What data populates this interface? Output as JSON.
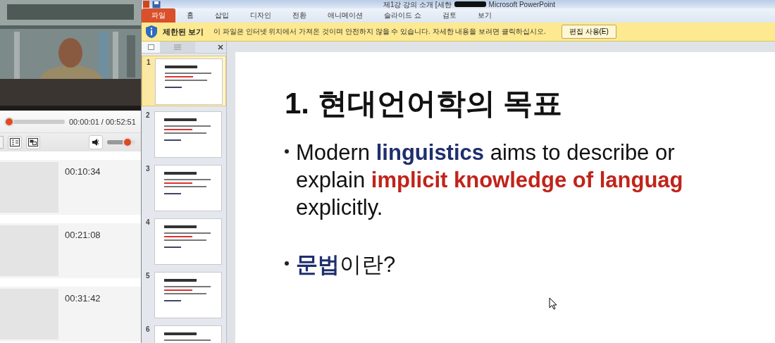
{
  "player": {
    "elapsed": "00:00:01 / 00:52:51",
    "progress": {
      "level": 0.0
    },
    "volume": {
      "level": 0.6
    }
  },
  "chapters": [
    {
      "time": "00:10:34"
    },
    {
      "time": "00:21:08"
    },
    {
      "time": "00:31:42"
    }
  ],
  "powerpoint": {
    "title": "제1강 강의 소개 [세한",
    "app_name": "Microsoft PowerPoint",
    "tabs": [
      {
        "label": "파일",
        "selected": true
      },
      {
        "label": "홈",
        "selected": false
      },
      {
        "label": "삽입",
        "selected": false
      },
      {
        "label": "디자인",
        "selected": false
      },
      {
        "label": "전환",
        "selected": false
      },
      {
        "label": "애니메이션",
        "selected": false
      },
      {
        "label": "슬라이드 쇼",
        "selected": false
      },
      {
        "label": "검토",
        "selected": false
      },
      {
        "label": "보기",
        "selected": false
      }
    ],
    "message_bar": {
      "heading": "제한된 보기",
      "text": "이 파일은 인터넷 위치에서 가져온 것이며 안전하지 않을 수 있습니다. 자세한 내용을 보려면 클릭하십시오.",
      "button": "편집 사용(E)"
    },
    "slides": [
      {
        "number": "1",
        "selected": true
      },
      {
        "number": "2",
        "selected": false
      },
      {
        "number": "3",
        "selected": false
      },
      {
        "number": "4",
        "selected": false
      },
      {
        "number": "5",
        "selected": false
      },
      {
        "number": "6",
        "selected": false
      }
    ],
    "current_slide": {
      "title": "1. 현대언어학의 목표",
      "bullets": [
        {
          "lines": [
            [
              {
                "text": "Modern ",
                "kind": "plain"
              },
              {
                "text": "linguistics",
                "kind": "key"
              },
              {
                "text": " aims to describe or",
                "kind": "plain"
              }
            ],
            [
              {
                "text": "explain ",
                "kind": "plain"
              },
              {
                "text": "implicit knowledge of languag",
                "kind": "accent"
              }
            ],
            [
              {
                "text": "explicitly.",
                "kind": "plain"
              }
            ]
          ]
        },
        {
          "lines": [
            [
              {
                "text": "문법",
                "kind": "key"
              },
              {
                "text": "이란?",
                "kind": "plain"
              }
            ]
          ]
        }
      ]
    }
  }
}
